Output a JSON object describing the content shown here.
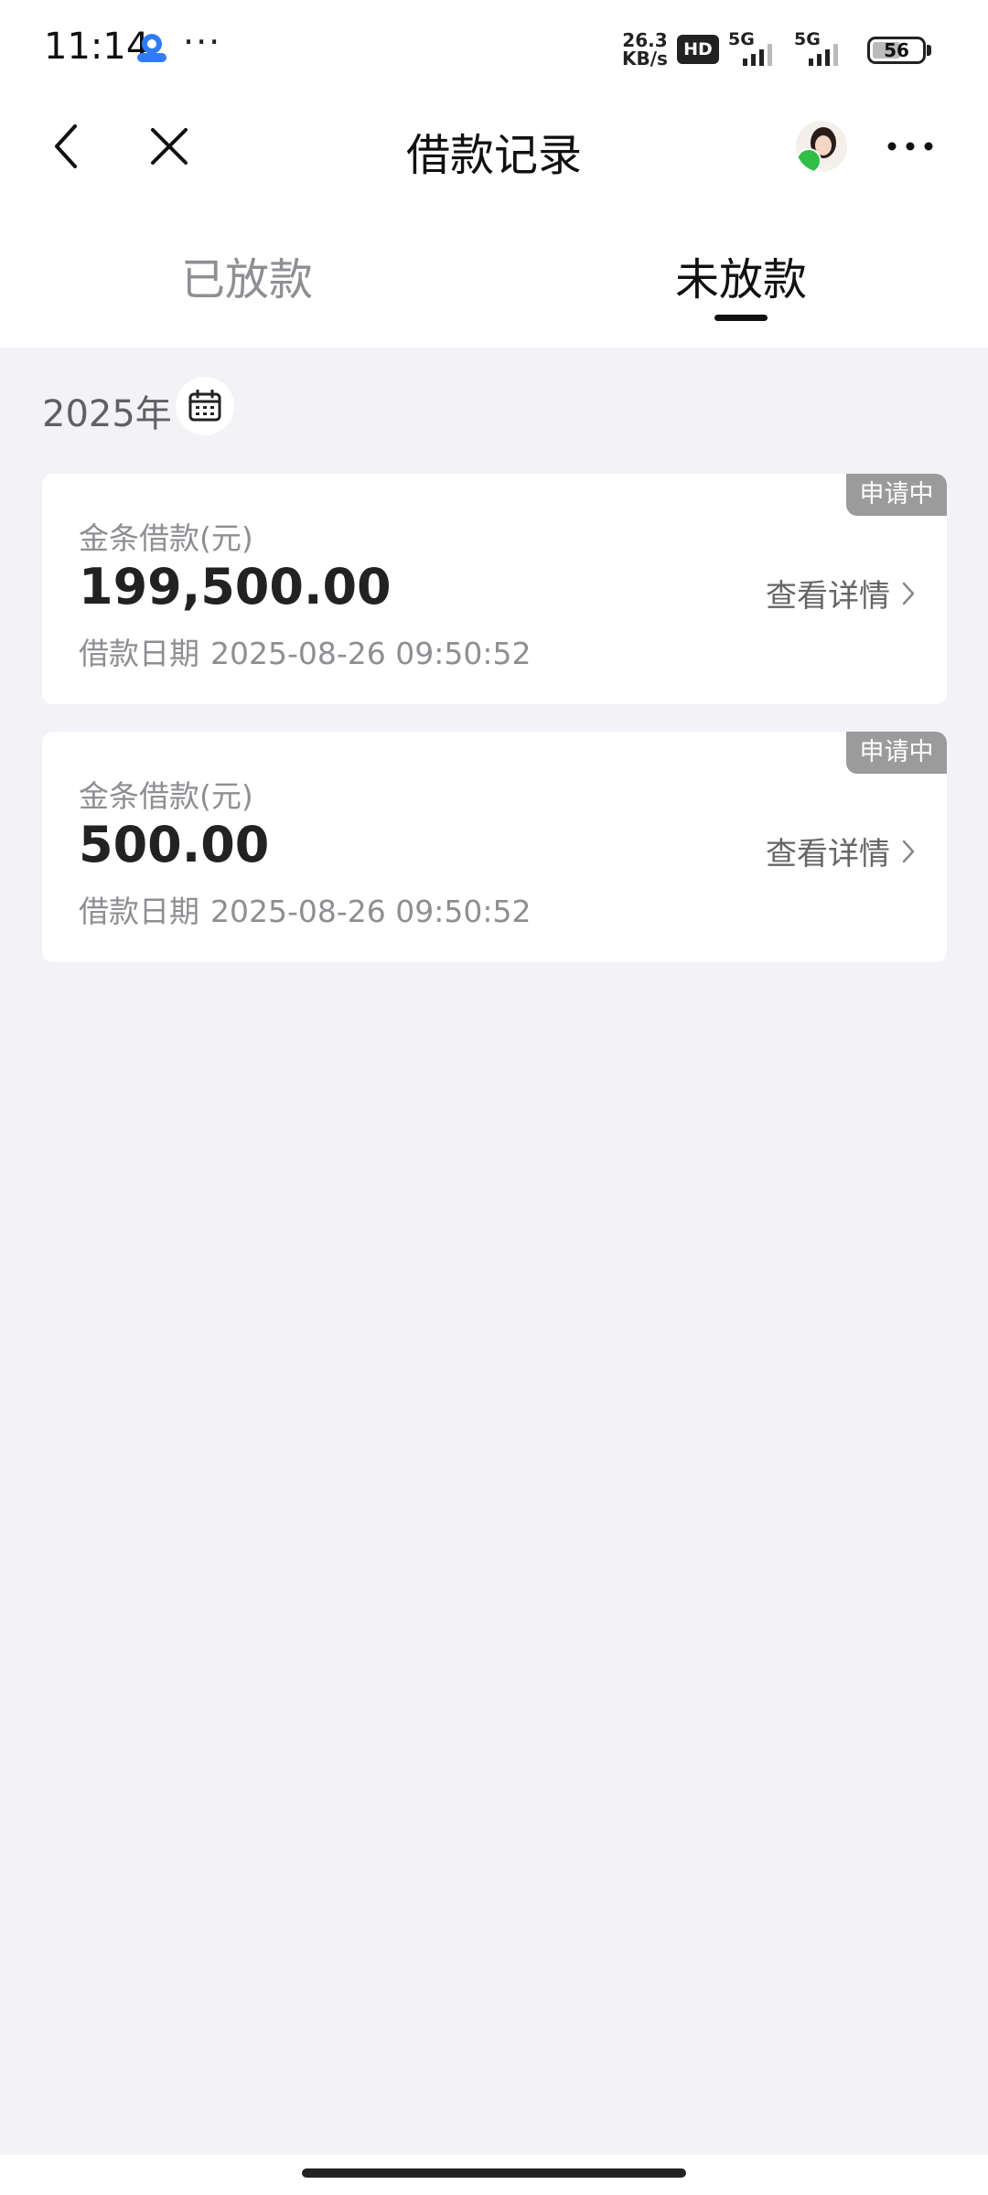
{
  "status_bar": {
    "time": "11:14",
    "dots": "···",
    "net_speed_value": "26.3",
    "net_speed_unit": "KB/s",
    "hd_label": "HD",
    "sim1_label": "5G",
    "sim2_label": "5G",
    "battery": "56"
  },
  "nav": {
    "title": "借款记录"
  },
  "tabs": [
    {
      "label": "已放款",
      "active": false
    },
    {
      "label": "未放款",
      "active": true
    }
  ],
  "filter": {
    "year": "2025年"
  },
  "records": [
    {
      "badge": "申请中",
      "label": "金条借款(元)",
      "amount": "199,500.00",
      "date_label": "借款日期",
      "date": "2025-08-26 09:50:52",
      "detail_link": "查看详情"
    },
    {
      "badge": "申请中",
      "label": "金条借款(元)",
      "amount": "500.00",
      "date_label": "借款日期",
      "date": "2025-08-26 09:50:52",
      "detail_link": "查看详情"
    }
  ],
  "colors": {
    "page_bg": "#f2f2f7",
    "badge_bg": "#9b9b9b",
    "active_tab": "#111111",
    "inactive_tab": "#8e8e93"
  }
}
